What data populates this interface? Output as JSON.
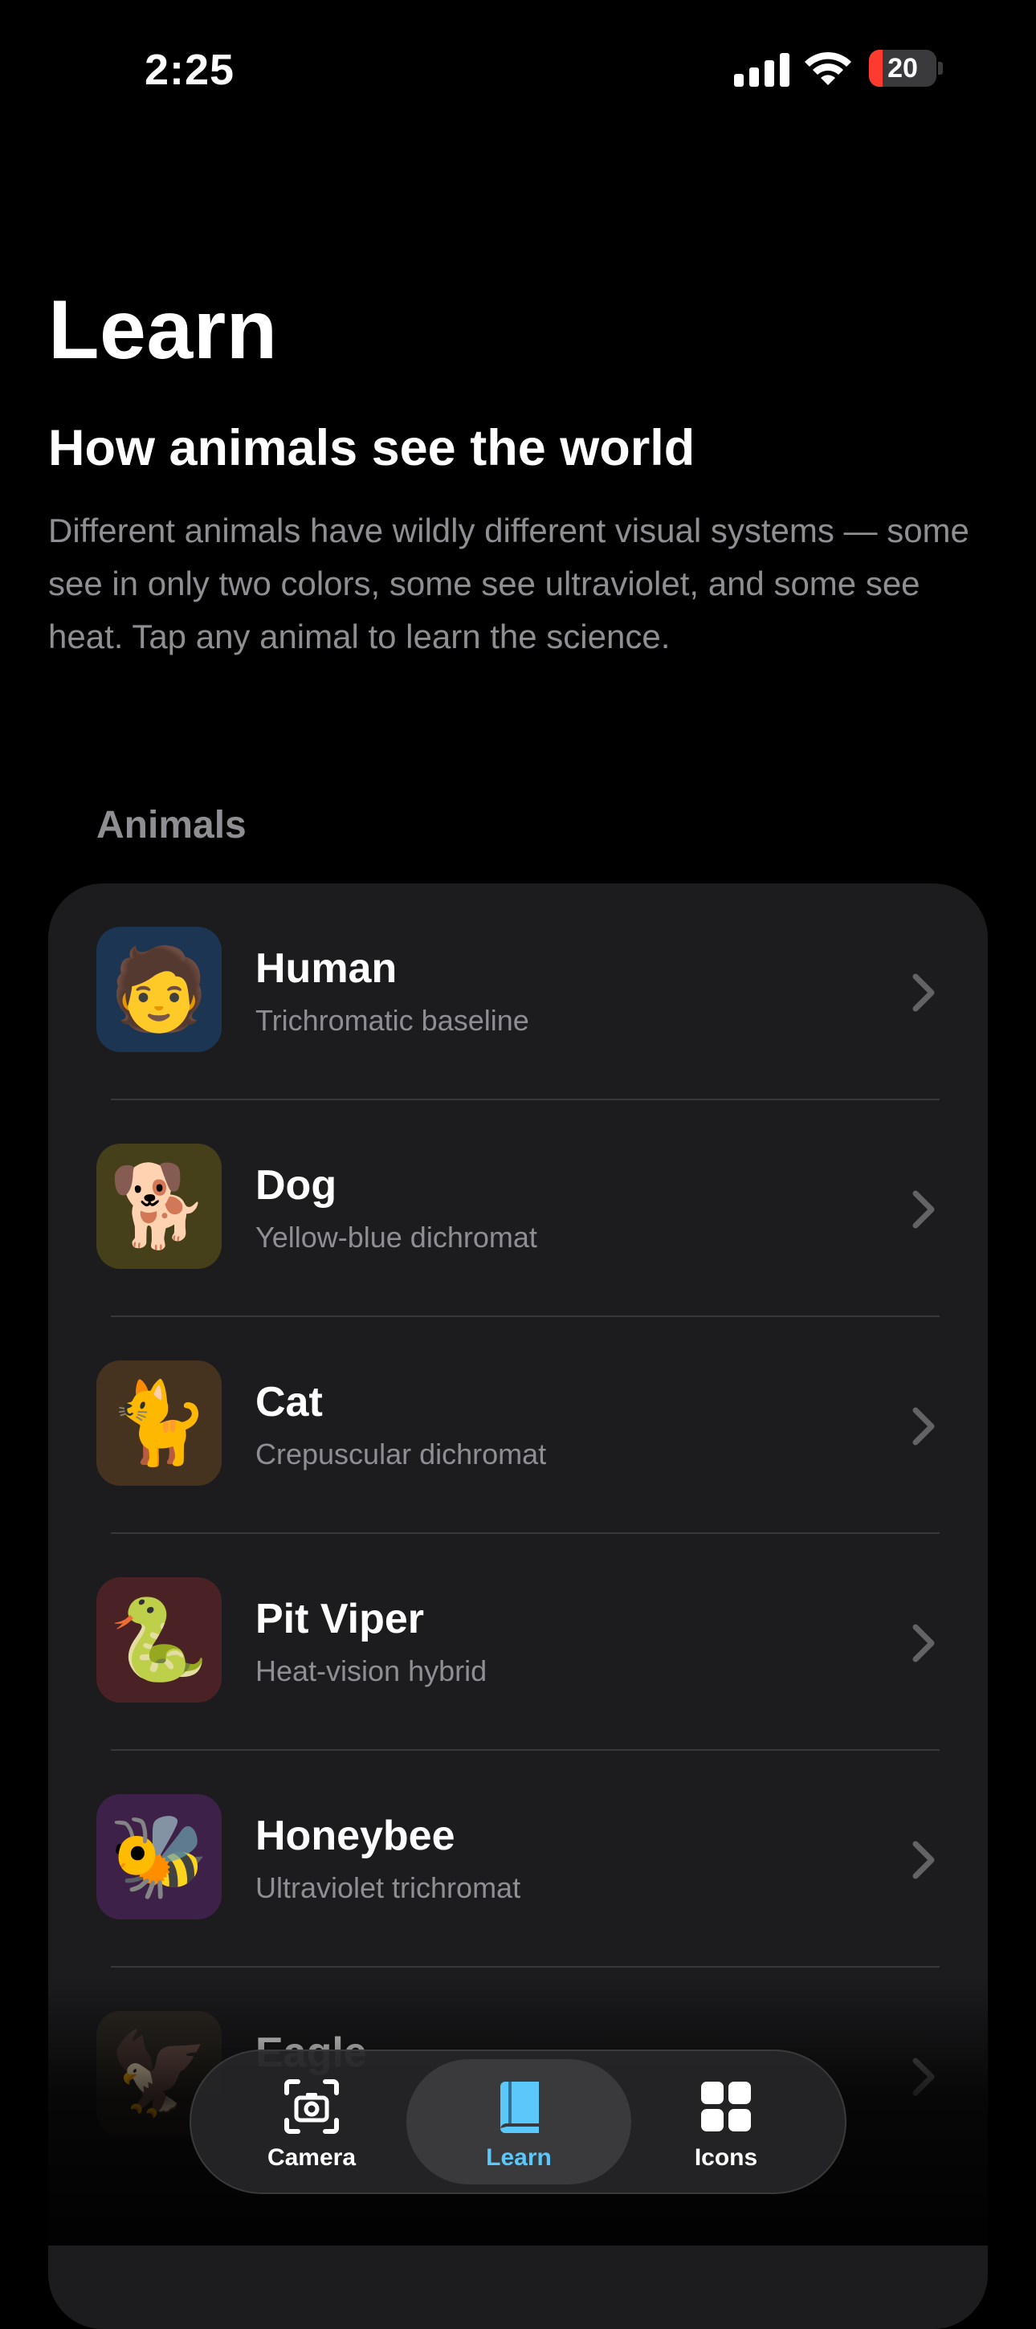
{
  "status_bar": {
    "time": "2:25",
    "battery": "20"
  },
  "header": {
    "title": "Learn",
    "subtitle": "How animals see the world",
    "description": "Different animals have wildly different visual systems — some see in only two colors, some see ultraviolet, and some see heat. Tap any animal to learn the science."
  },
  "list": {
    "header": "Animals",
    "items": [
      {
        "name": "Human",
        "subtitle": "Trichromatic baseline",
        "emoji": "🧑",
        "icon_bg": "#1b3552"
      },
      {
        "name": "Dog",
        "subtitle": "Yellow-blue dichromat",
        "emoji": "🐕",
        "icon_bg": "#46401a"
      },
      {
        "name": "Cat",
        "subtitle": "Crepuscular dichromat",
        "emoji": "🐈",
        "icon_bg": "#45321f"
      },
      {
        "name": "Pit Viper",
        "subtitle": "Heat-vision hybrid",
        "emoji": "🐍",
        "icon_bg": "#4a2225"
      },
      {
        "name": "Honeybee",
        "subtitle": "Ultraviolet trichromat",
        "emoji": "🐝",
        "icon_bg": "#3e2148"
      },
      {
        "name": "Eagle",
        "subtitle": "",
        "emoji": "🦅",
        "icon_bg": "#2e2a24"
      }
    ]
  },
  "tabs": [
    {
      "label": "Camera",
      "icon": "camera-icon"
    },
    {
      "label": "Learn",
      "icon": "book-icon",
      "active": true
    },
    {
      "label": "Icons",
      "icon": "grid-icon"
    }
  ],
  "colors": {
    "accent": "#5ac8fa",
    "battery_low": "#ff3b30"
  }
}
